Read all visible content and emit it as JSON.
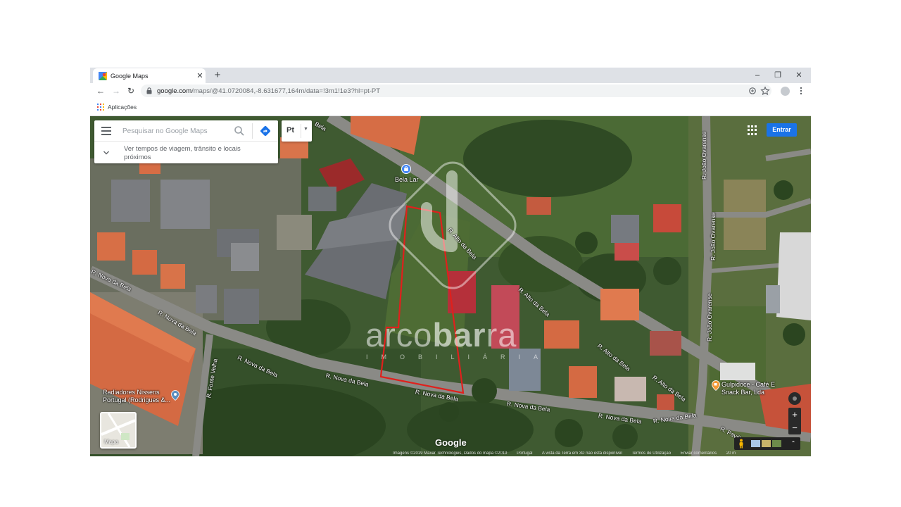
{
  "browser": {
    "tab_title": "Google Maps",
    "tab_close": "✕",
    "new_tab": "+",
    "minimize": "–",
    "maximize": "❐",
    "close": "✕",
    "url_host": "google.com",
    "url_path": "/maps/@41.0720084,-8.631677,164m/data=!3m1!1e3?hl=pt-PT",
    "back": "←",
    "forward": "→",
    "reload": "↻"
  },
  "bookmarks": {
    "apps_label": "Aplicações"
  },
  "maps": {
    "search_placeholder": "Pesquisar no Google Maps",
    "travel_hint": "Ver tempos de viagem, trânsito e locais próximos",
    "language": "Pt",
    "signin": "Entrar",
    "layer_label": "Mapa",
    "logo": "Google",
    "zoom_in": "+",
    "zoom_out": "−",
    "expand": "⌃",
    "attribution": [
      "Imagens ©2019 Maxar Technologies, Dados do mapa ©2019",
      "Portugal",
      "A vista da Terra em 3D não está disponível",
      "Termos de Utilização",
      "Enviar comentários",
      "20 m"
    ]
  },
  "streets": {
    "alto_bela_1": "R. Alto da Bela",
    "alto_bela_2": "R. Alto da Bela",
    "alto_bela_3": "R. Alto da Bela",
    "alto_bela_4": "R. Alto da Bela",
    "nova_bela_1": "R. Nova da Bela",
    "nova_bela_2": "R. Nova da Bela",
    "nova_bela_3": "R. Nova da Bela",
    "nova_bela_4": "R. Nova da Bela",
    "nova_bela_5": "R. Nova da Bela",
    "nova_bela_6": "R. Nova da Bela",
    "nova_bela_7": "R. Nova da Bela",
    "nova_bela_8": "R. Nova da Bela",
    "joao_ovarense_1": "R. João Ovarense",
    "joao_ovarense_2": "R. João Ovarense",
    "joao_ovarense_3": "R. João Ovarense",
    "fonte_velha": "R. Fonte Velha",
    "pavilhao": "R. Pavilhão",
    "bela_top": "Bela"
  },
  "pois": {
    "bela_lar": "Bela Lar",
    "radiadores": "Radiadores Nissens Portugal (Rodrigues &...",
    "gulpidoce": "Gulpidoce - Café E Snack Bar, Lda"
  },
  "watermark": {
    "light": "arco",
    "bold": "bar",
    "end": "ra",
    "sub": "IMOBILIÁRIA"
  },
  "colors": {
    "plot_outline": "#e0201c",
    "signin": "#1a73e8"
  }
}
